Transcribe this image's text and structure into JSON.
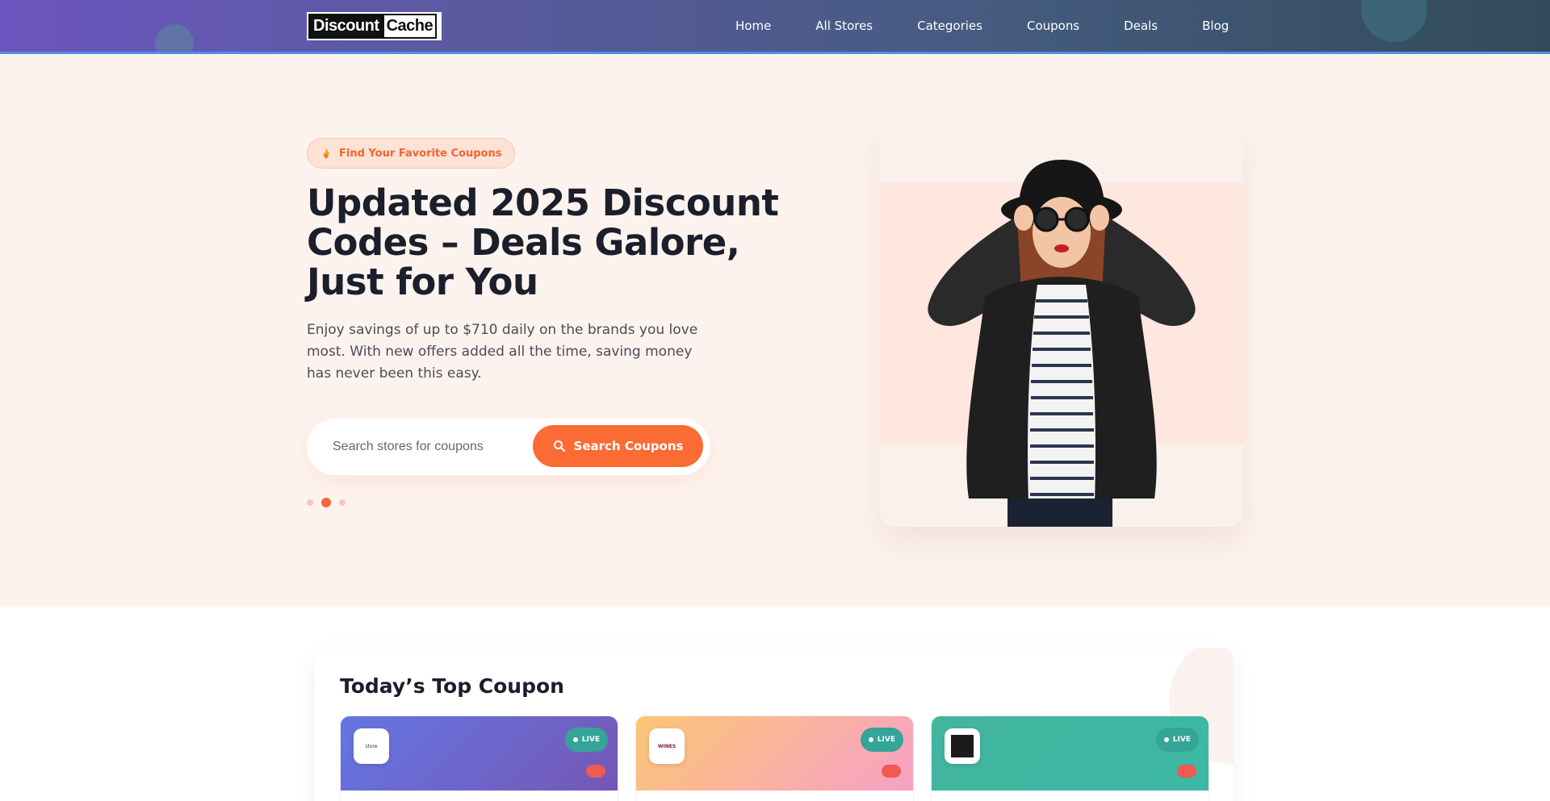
{
  "header": {
    "logo_left": "Discount",
    "logo_right": "Cache",
    "nav": [
      "Home",
      "All Stores",
      "Categories",
      "Coupons",
      "Deals",
      "Blog"
    ]
  },
  "hero": {
    "badge": "Find Your Favorite Coupons",
    "title": "Updated 2025 Discount Codes – Deals Galore, Just for You",
    "subtitle": "Enjoy savings of up to $710 daily on the brands you love most. With new offers added all the time, saving money has never been this easy.",
    "search": {
      "placeholder": "Search stores for coupons",
      "button_label": "Search Coupons"
    },
    "carousel": {
      "total": 3,
      "active": 2
    }
  },
  "coupons_section": {
    "title": "Today’s Top Coupon",
    "cards": [
      {
        "store": "store",
        "status": "LIVE"
      },
      {
        "store": "WINES",
        "status": "LIVE"
      },
      {
        "store": "",
        "status": "LIVE"
      }
    ]
  },
  "colors": {
    "accent": "#fb6b34",
    "header_start": "#6c55bf",
    "header_end": "#324b5a",
    "hero_bg": "#fdf3ee",
    "live_badge": "#35a59a"
  }
}
